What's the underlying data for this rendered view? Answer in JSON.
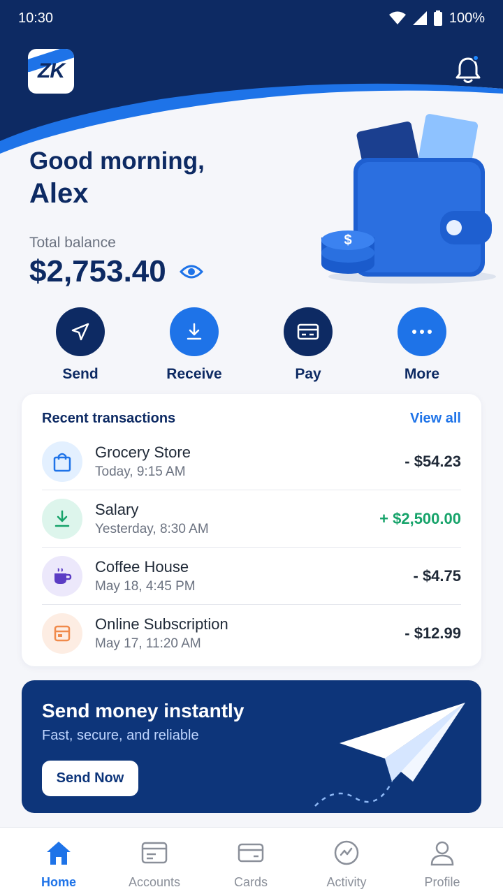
{
  "status_bar": {
    "time": "10:30",
    "battery": "100%"
  },
  "header": {
    "logo_text": "ZK"
  },
  "greeting": {
    "line1": "Good morning,",
    "name": "Alex"
  },
  "balance": {
    "label": "Total balance",
    "value": "$2,753.40"
  },
  "actions": [
    {
      "label": "Send"
    },
    {
      "label": "Receive"
    },
    {
      "label": "Pay"
    },
    {
      "label": "More"
    }
  ],
  "transactions": {
    "title": "Recent transactions",
    "view_all": "View all",
    "items": [
      {
        "name": "Grocery Store",
        "time": "Today, 9:15 AM",
        "amount": "- $54.23",
        "icon": "shopping-bag-icon"
      },
      {
        "name": "Salary",
        "time": "Yesterday, 8:30 AM",
        "amount": "+ $2,500.00",
        "icon": "download-icon"
      },
      {
        "name": "Coffee House",
        "time": "May 18, 4:45 PM",
        "amount": "- $4.75",
        "icon": "coffee-icon"
      },
      {
        "name": "Online Subscription",
        "time": "May 17, 11:20 AM",
        "amount": "- $12.99",
        "icon": "subscription-icon"
      }
    ]
  },
  "promo": {
    "title": "Send money instantly",
    "subtitle": "Fast, secure, and reliable",
    "button": "Send Now"
  },
  "nav": [
    {
      "label": "Home",
      "active": true
    },
    {
      "label": "Accounts"
    },
    {
      "label": "Cards"
    },
    {
      "label": "Activity"
    },
    {
      "label": "Profile"
    }
  ],
  "colors": {
    "primary_dark": "#0D2A63",
    "primary_blue": "#1E73E8",
    "positive": "#16A36A",
    "background": "#F5F6FA"
  }
}
